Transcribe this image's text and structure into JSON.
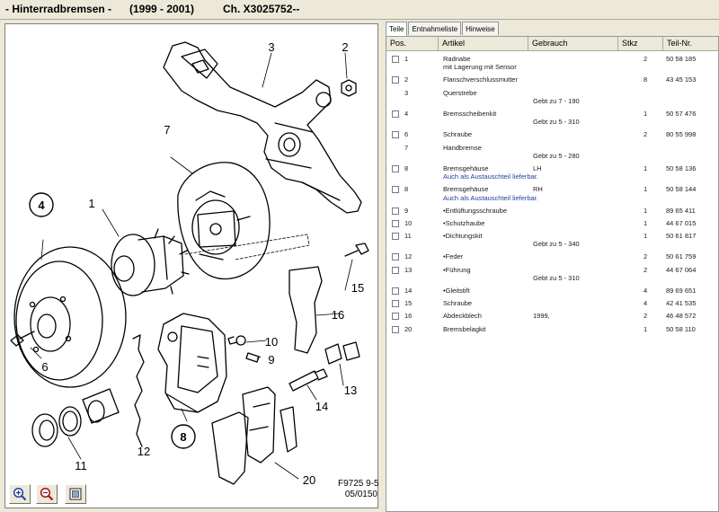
{
  "header": {
    "title_part1": "- Hinterradbremsen -",
    "title_part2": "(1999 - 2001)",
    "title_part3": "Ch. X3025752--"
  },
  "diagram": {
    "callouts": [
      "3",
      "2",
      "7",
      "1",
      "4",
      "15",
      "16",
      "10",
      "9",
      "6",
      "13",
      "14",
      "12",
      "8",
      "11",
      "20"
    ],
    "fig_code_line1": "F9725 9-5",
    "fig_code_line2": "05/0150"
  },
  "tabs": [
    "Teile",
    "Entnahmeliste",
    "Hinweise"
  ],
  "columns": [
    "Pos.",
    "Artikel",
    "Gebrauch",
    "Stkz",
    "Teil-Nr."
  ],
  "rows": [
    {
      "pos": "1",
      "checkbox": true,
      "artikel": "Radnabe",
      "artikel_note": "mit Lagerung  mit Sensor",
      "gebrauch": "",
      "gebrauch_line2": "",
      "stkz": "2",
      "teilnr": "50 58 185"
    },
    {
      "pos": "2",
      "checkbox": true,
      "artikel": "Flanschverschlussmutter",
      "artikel_note": "",
      "gebrauch": "",
      "gebrauch_line2": "",
      "stkz": "8",
      "teilnr": "43 45 153"
    },
    {
      "pos": "3",
      "checkbox": false,
      "artikel": "Querstrebe",
      "artikel_note": "",
      "gebrauch": "",
      "gebrauch_line2": "Gebt zu 7 - 190",
      "stkz": "",
      "teilnr": ""
    },
    {
      "pos": "4",
      "checkbox": true,
      "artikel": "Bremsscheibenkit",
      "artikel_note": "",
      "gebrauch": "",
      "gebrauch_line2": "Gebt zu 5 - 310",
      "stkz": "1",
      "teilnr": "50 57 476"
    },
    {
      "pos": "6",
      "checkbox": true,
      "artikel": "Schraube",
      "artikel_note": "",
      "gebrauch": "",
      "gebrauch_line2": "",
      "stkz": "2",
      "teilnr": "80 55 998"
    },
    {
      "pos": "7",
      "checkbox": false,
      "artikel": "Handbremse",
      "artikel_note": "",
      "gebrauch": "",
      "gebrauch_line2": "Gebt zu 5 - 280",
      "stkz": "",
      "teilnr": ""
    },
    {
      "pos": "8",
      "checkbox": true,
      "artikel": "Bremsgehäuse",
      "artikel_note": "Auch als Austauschteil lieferbar.",
      "gebrauch": "LH",
      "gebrauch_line2": "",
      "stkz": "1",
      "teilnr": "50 58 136"
    },
    {
      "pos": "8",
      "checkbox": true,
      "artikel": "Bremsgehäuse",
      "artikel_note": "Auch als Austauschteil lieferbar.",
      "gebrauch": "RH",
      "gebrauch_line2": "",
      "stkz": "1",
      "teilnr": "50 58 144"
    },
    {
      "pos": "9",
      "checkbox": true,
      "artikel": "•Entlüftungsschraube",
      "artikel_note": "",
      "gebrauch": "",
      "gebrauch_line2": "",
      "stkz": "1",
      "teilnr": "89 65 411"
    },
    {
      "pos": "10",
      "checkbox": true,
      "artikel": "•Schutzhaube",
      "artikel_note": "",
      "gebrauch": "",
      "gebrauch_line2": "",
      "stkz": "1",
      "teilnr": "44 67 015"
    },
    {
      "pos": "11",
      "checkbox": true,
      "artikel": "•Dichtungskit",
      "artikel_note": "",
      "gebrauch": "",
      "gebrauch_line2": "Gebt zu 5 - 340",
      "stkz": "1",
      "teilnr": "50 61 817"
    },
    {
      "pos": "12",
      "checkbox": true,
      "artikel": "•Feder",
      "artikel_note": "",
      "gebrauch": "",
      "gebrauch_line2": "",
      "stkz": "2",
      "teilnr": "50 61 759"
    },
    {
      "pos": "13",
      "checkbox": true,
      "artikel": "•Führung",
      "artikel_note": "",
      "gebrauch": "",
      "gebrauch_line2": "Gebt zu 5 - 310",
      "stkz": "2",
      "teilnr": "44 67 064"
    },
    {
      "pos": "14",
      "checkbox": true,
      "artikel": "•Gleitstift",
      "artikel_note": "",
      "gebrauch": "",
      "gebrauch_line2": "",
      "stkz": "4",
      "teilnr": "89 69 651"
    },
    {
      "pos": "15",
      "checkbox": true,
      "artikel": "Schraube",
      "artikel_note": "",
      "gebrauch": "",
      "gebrauch_line2": "",
      "stkz": "4",
      "teilnr": "42 41 535"
    },
    {
      "pos": "16",
      "checkbox": true,
      "artikel": "Abdeckblech",
      "artikel_note": "",
      "gebrauch": "1999,",
      "gebrauch_line2": "",
      "stkz": "2",
      "teilnr": "46 48 572"
    },
    {
      "pos": "20",
      "checkbox": true,
      "artikel": "Bremsbelagkit",
      "artikel_note": "",
      "gebrauch": "",
      "gebrauch_line2": "",
      "stkz": "1",
      "teilnr": "50 58 110"
    }
  ],
  "icons": {
    "zoom_in": "zoom-in-icon",
    "zoom_out": "zoom-out-icon",
    "fit": "fit-to-page-icon"
  }
}
